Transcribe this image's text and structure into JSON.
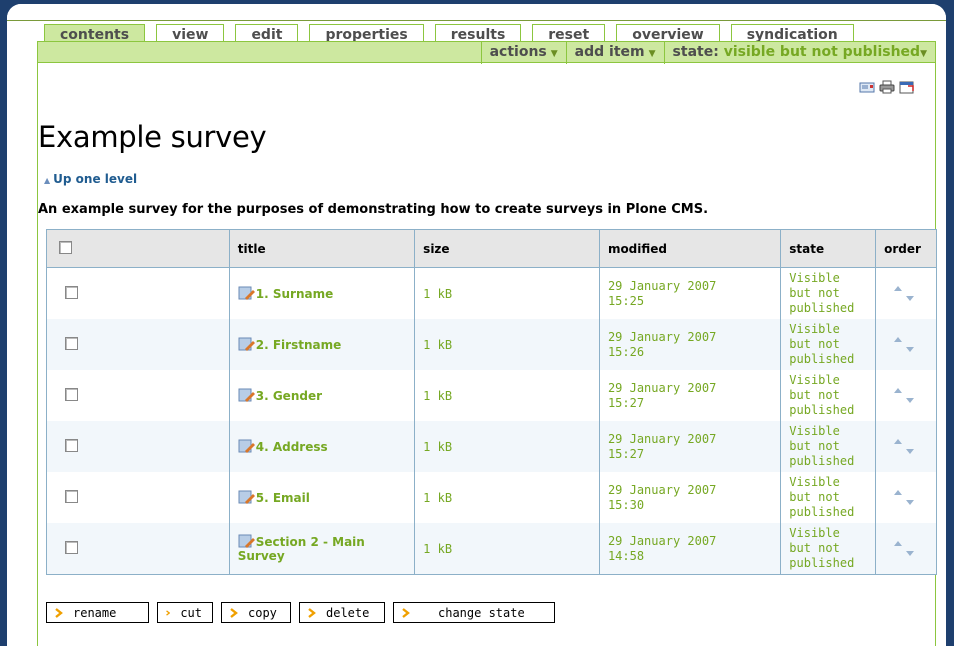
{
  "tabs": [
    {
      "label": "contents",
      "active": true
    },
    {
      "label": "view",
      "active": false
    },
    {
      "label": "edit",
      "active": false
    },
    {
      "label": "properties",
      "active": false
    },
    {
      "label": "results",
      "active": false
    },
    {
      "label": "reset",
      "active": false
    },
    {
      "label": "overview",
      "active": false
    },
    {
      "label": "syndication",
      "active": false
    }
  ],
  "menus": {
    "actions": "actions",
    "add_item": "add item",
    "state_label": "state:",
    "state_value": "visible but not published"
  },
  "doc_actions": [
    "send-to-icon",
    "print-icon",
    "full-screen-icon"
  ],
  "page": {
    "title": "Example survey",
    "up_level": "Up one level",
    "description": "An example survey for the purposes of demonstrating how to create surveys in Plone CMS."
  },
  "table": {
    "headers": {
      "title": "title",
      "size": "size",
      "modified": "modified",
      "state": "state",
      "order": "order"
    },
    "rows": [
      {
        "title": "1. Surname",
        "size": "1 kB",
        "date": "29 January 2007",
        "time": "15:25",
        "state": [
          "Visible",
          "but not",
          "published"
        ]
      },
      {
        "title": "2. Firstname",
        "size": "1 kB",
        "date": "29 January 2007",
        "time": "15:26",
        "state": [
          "Visible",
          "but not",
          "published"
        ]
      },
      {
        "title": "3. Gender",
        "size": "1 kB",
        "date": "29 January 2007",
        "time": "15:27",
        "state": [
          "Visible",
          "but not",
          "published"
        ]
      },
      {
        "title": "4. Address",
        "size": "1 kB",
        "date": "29 January 2007",
        "time": "15:27",
        "state": [
          "Visible",
          "but not",
          "published"
        ]
      },
      {
        "title": "5. Email",
        "size": "1 kB",
        "date": "29 January 2007",
        "time": "15:30",
        "state": [
          "Visible",
          "but not",
          "published"
        ]
      },
      {
        "title": "Section 2 - Main Survey",
        "size": "1 kB",
        "date": "29 January 2007",
        "time": "14:58",
        "state": [
          "Visible",
          "but not",
          "published"
        ]
      }
    ]
  },
  "buttons": {
    "rename": "rename",
    "cut": "cut",
    "copy": "copy",
    "delete": "delete",
    "change_state": "change state"
  },
  "colors": {
    "accent_green": "#8cc63f",
    "tab_active_bg": "#cde8a0",
    "link_green": "#76a823",
    "frame_blue": "#1e3f6e"
  }
}
